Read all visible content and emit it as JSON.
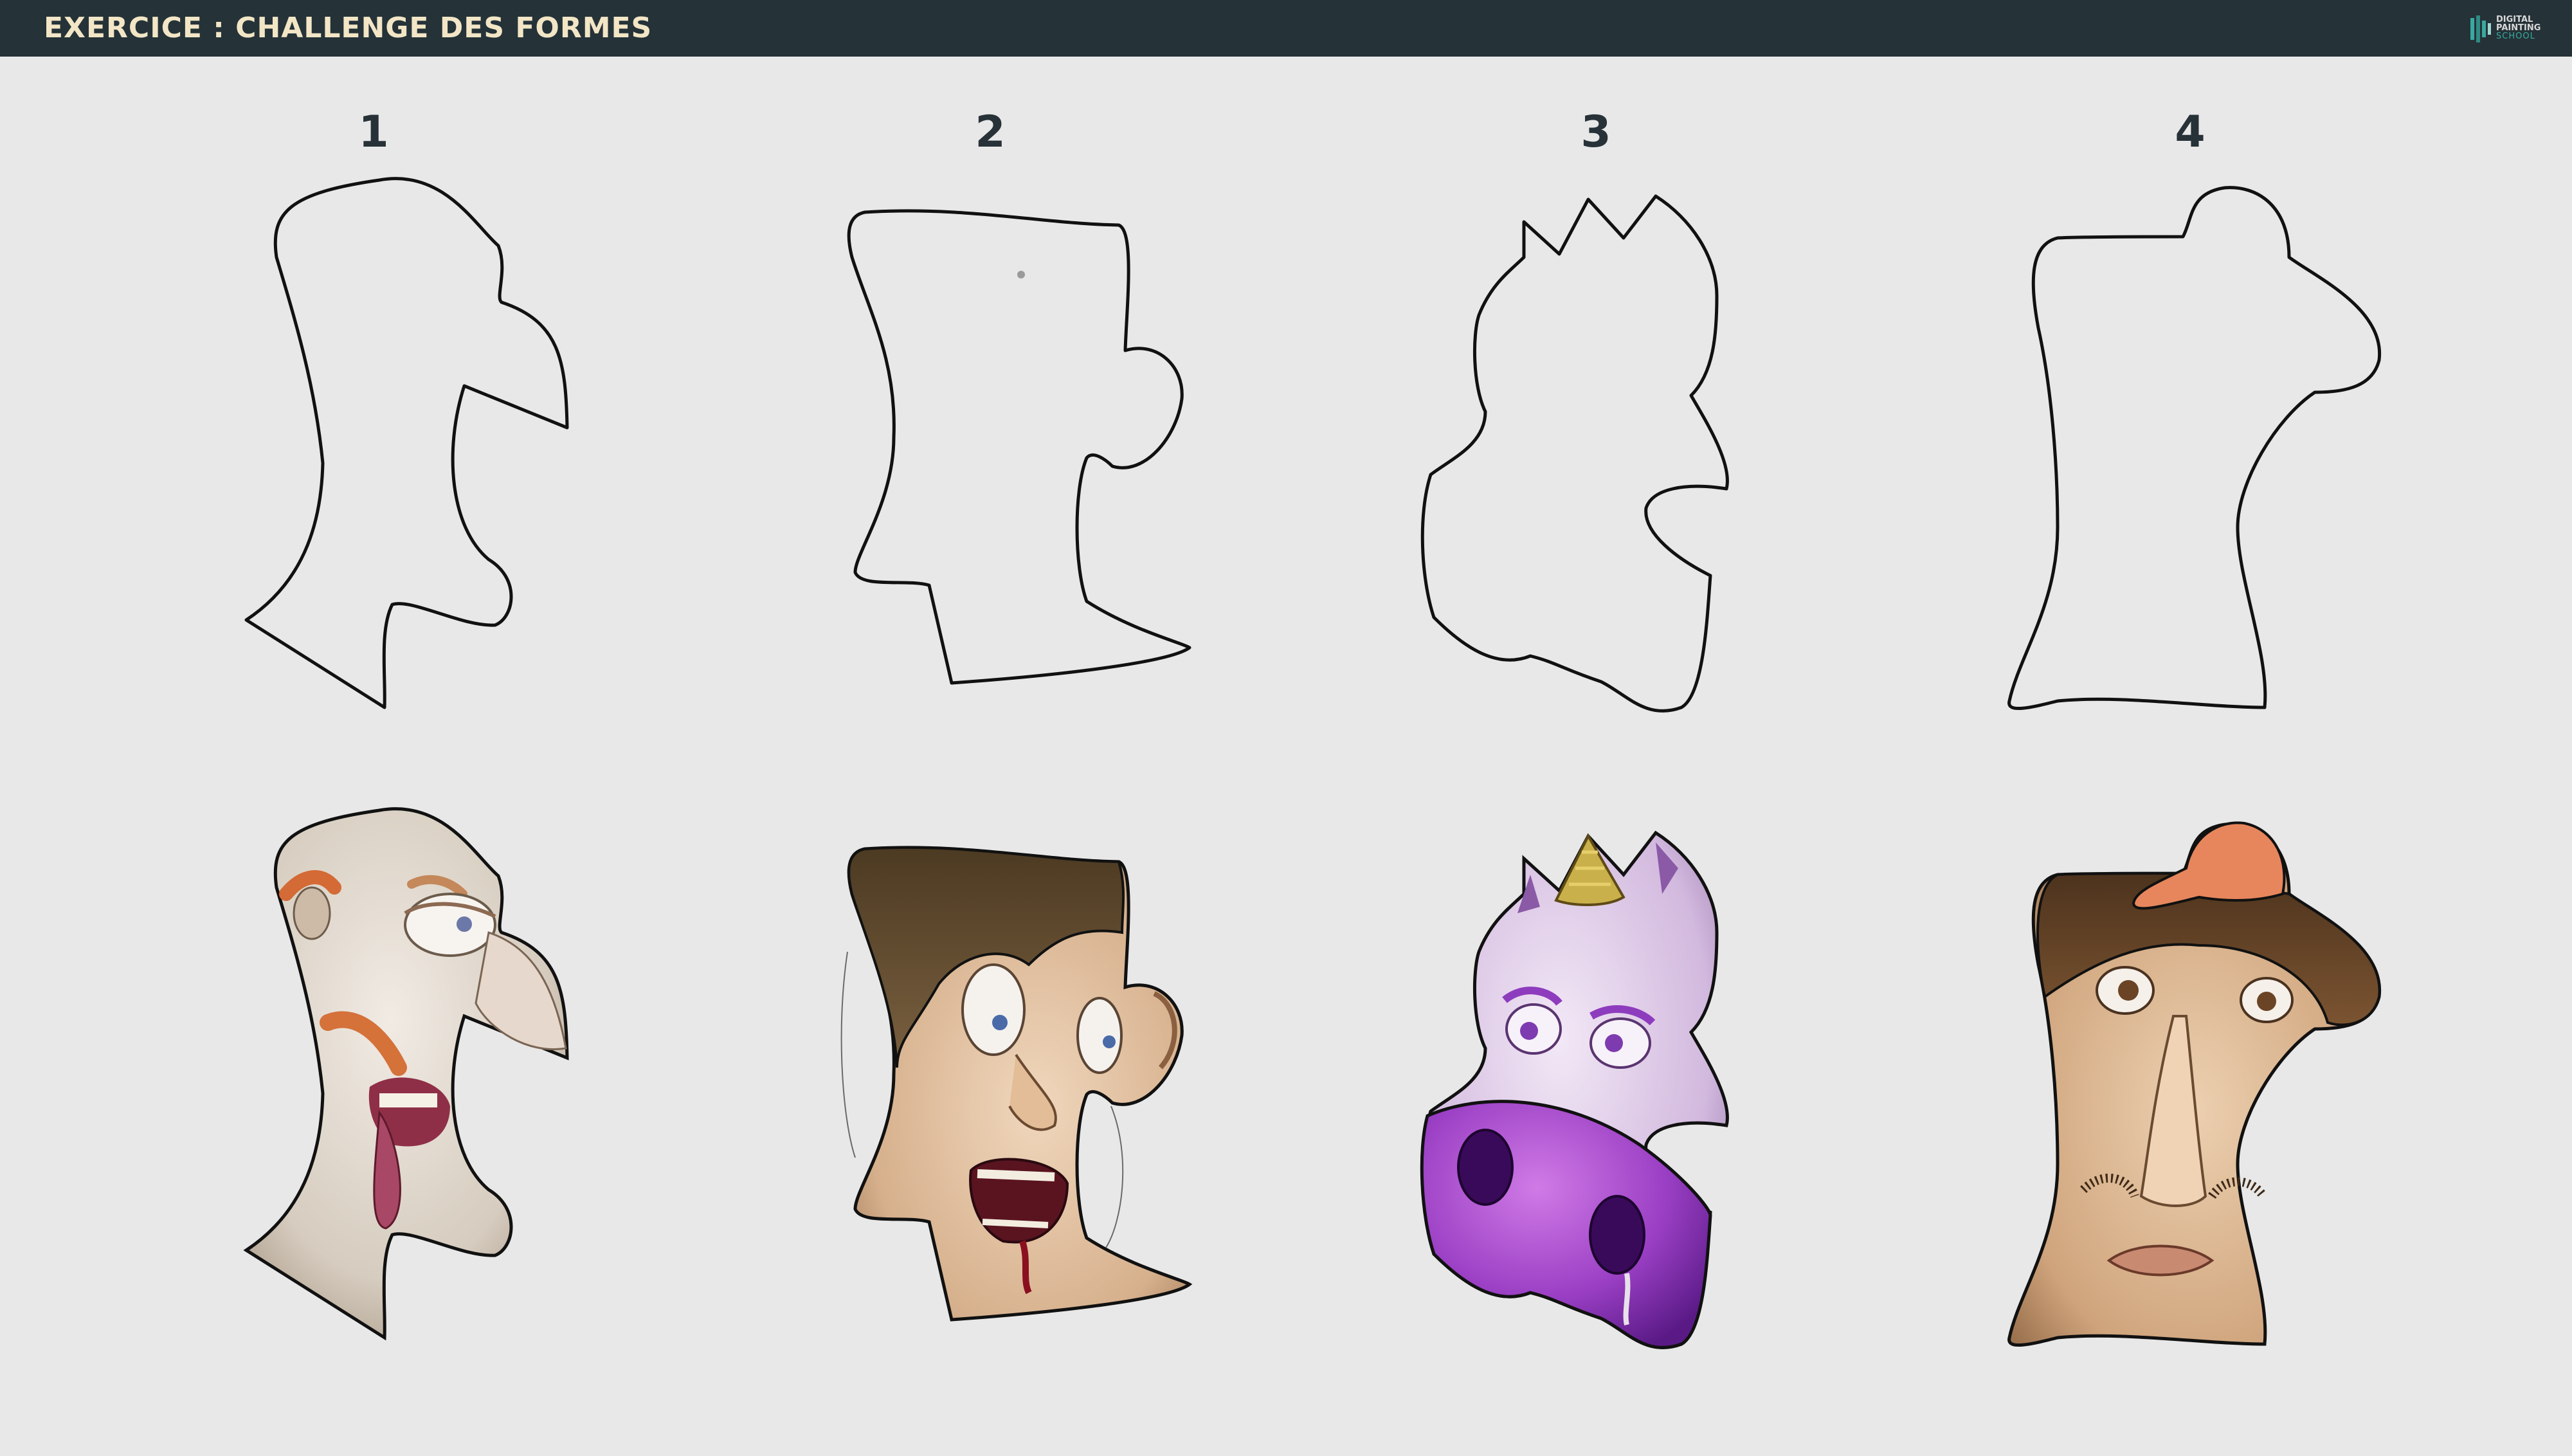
{
  "header": {
    "title": "EXERCICE : CHALLENGE DES FORMES",
    "logo_text": [
      "DIGITAL",
      "PAINTING",
      "SCHOOL"
    ]
  },
  "shapes": [
    {
      "number": "1",
      "character": "elderly man with long nose, red eyebrows and tongue out",
      "skin": "#d9cfc2"
    },
    {
      "number": "2",
      "character": "shouting man with brown hair, ear and fanged mouth",
      "skin": "#dbb897"
    },
    {
      "number": "3",
      "character": "purple unicorn pig with snout",
      "skin": "#d8c3e2"
    },
    {
      "number": "4",
      "character": "man with orange cap, big nose and mustache",
      "skin": "#d8b28c"
    }
  ],
  "colors": {
    "topbar": "#253238",
    "title": "#f2e6c6",
    "background": "#e8e8e8",
    "outline": "#111111",
    "accent": "#3aa99f"
  }
}
